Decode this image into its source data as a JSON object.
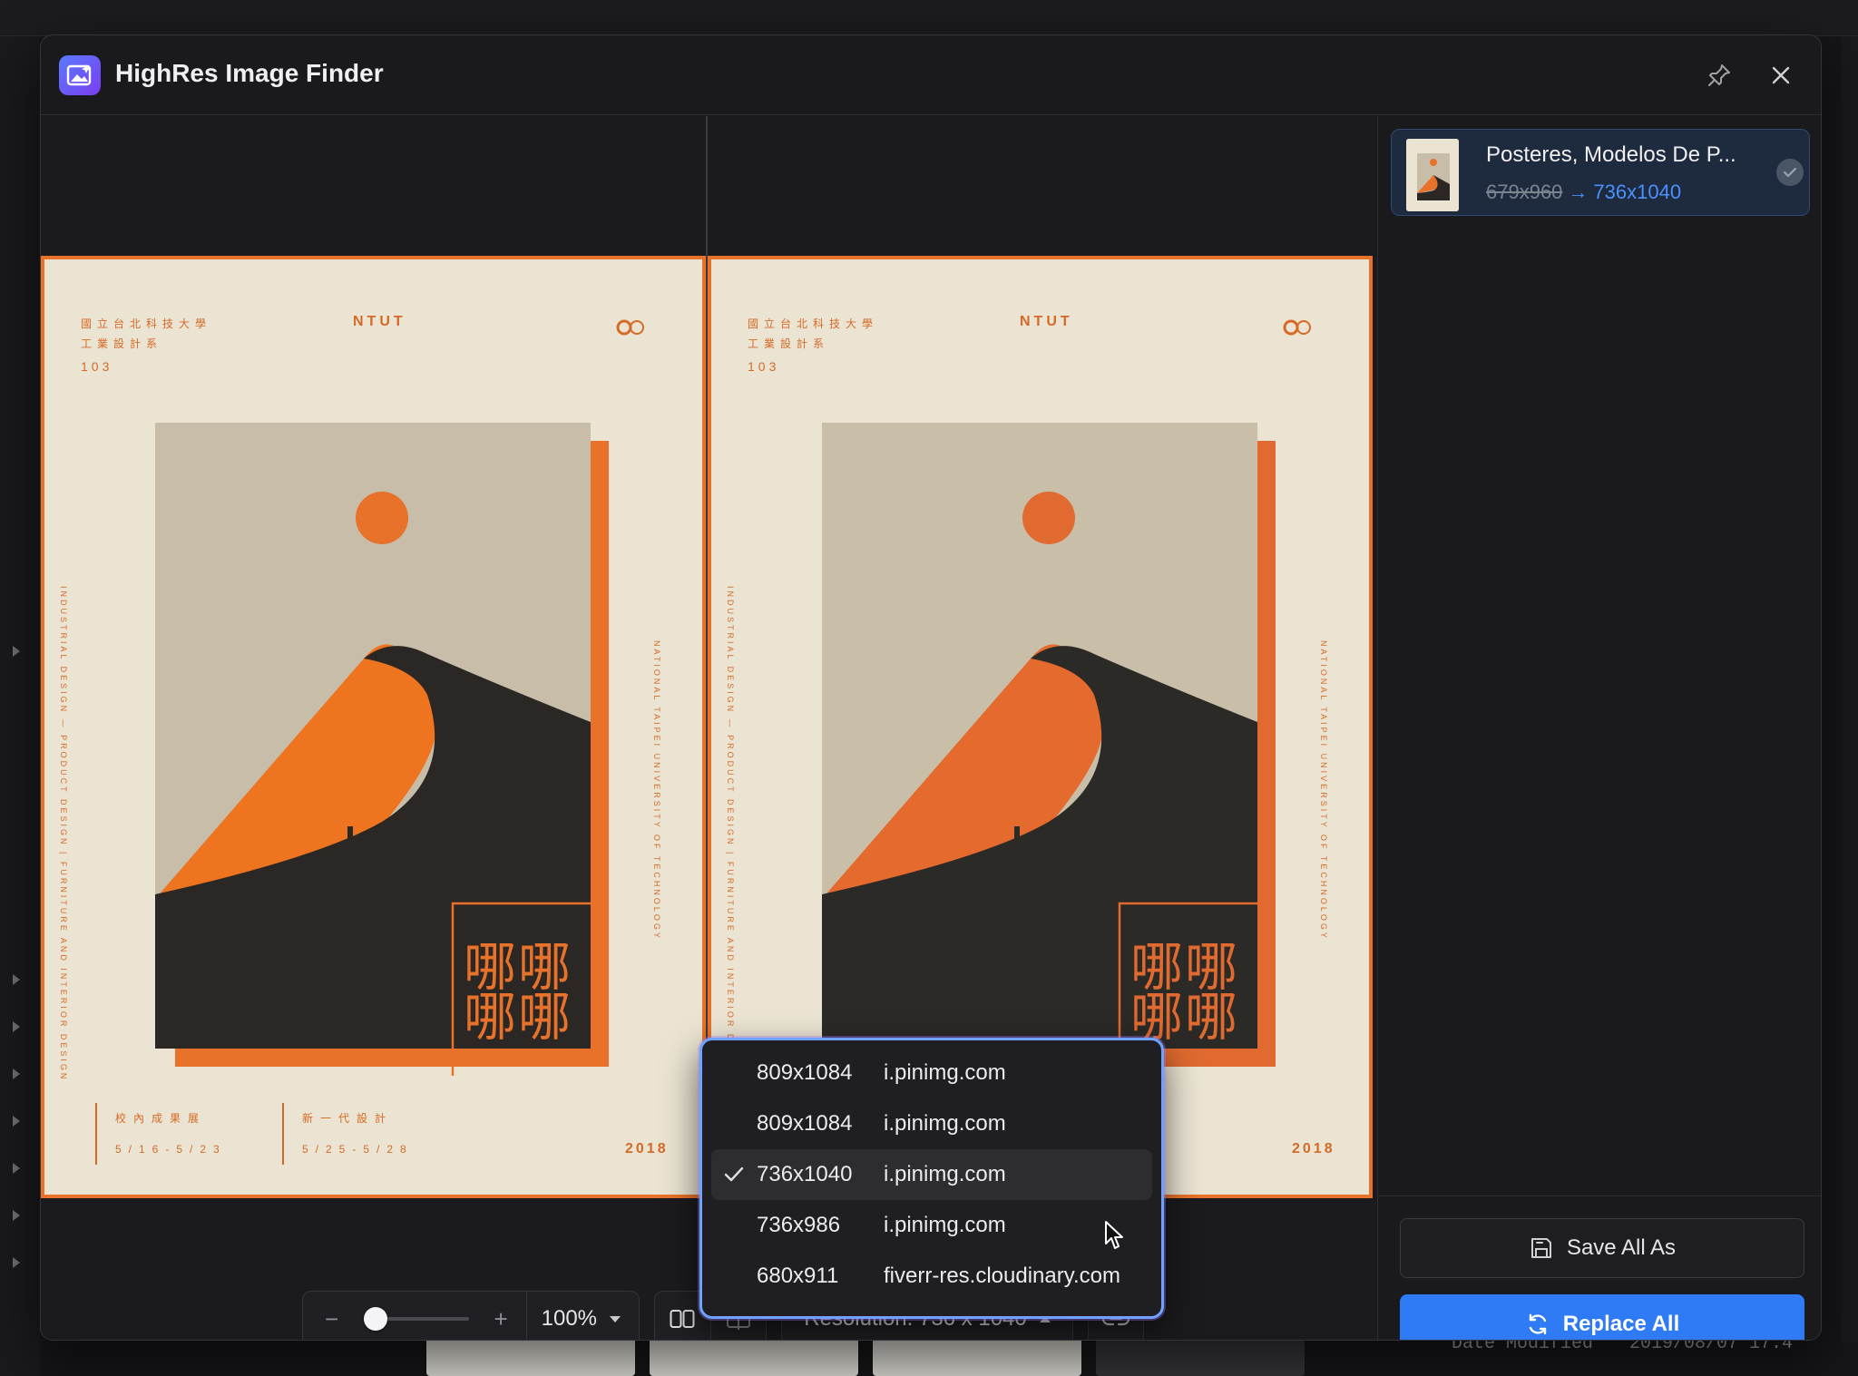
{
  "window": {
    "title": "HighRes Image Finder"
  },
  "poster": {
    "cjk_line1": "國立台北科技大學",
    "cjk_line2": "工業設計系",
    "number": "103",
    "school": "NTUT",
    "vertical_left": "INDUSTRIAL DESIGN — PRODUCT DESIGN | FURNITURE AND INTERIOR DESIGN",
    "vertical_right": "NATIONAL TAIPEI UNIVERSITY OF TECHNOLOGY",
    "footer1_title": "校內成果展",
    "footer1_date": "5/16-5/23",
    "footer2_title": "新一代設計",
    "footer2_date": "5/25-5/28",
    "year": "2018"
  },
  "toolbar": {
    "zoom_minus": "−",
    "zoom_plus": "+",
    "zoom_value": "100%",
    "zoom_level": 0.0,
    "resolution_label": "Resolution: 736 x 1040"
  },
  "resolution_menu": {
    "items": [
      {
        "resolution": "809x1084",
        "host": "i.pinimg.com",
        "selected": false
      },
      {
        "resolution": "809x1084",
        "host": "i.pinimg.com",
        "selected": false
      },
      {
        "resolution": "736x1040",
        "host": "i.pinimg.com",
        "selected": true
      },
      {
        "resolution": "736x986",
        "host": "i.pinimg.com",
        "selected": false
      },
      {
        "resolution": "680x911",
        "host": "fiverr-res.cloudinary.com",
        "selected": false
      }
    ]
  },
  "sidebar": {
    "result": {
      "title": "Posteres, Modelos De P...",
      "old_size": "679x960",
      "arrow": "→",
      "new_size": "736x1040"
    },
    "save_all_label": "Save All As",
    "replace_all_label": "Replace All"
  },
  "background": {
    "meta_label": "Date Modified",
    "meta_value": "2019/08/07 17:4"
  },
  "colors": {
    "accent_blue": "#2f7bf5",
    "poster_orange": "#e8722a",
    "poster_bg": "#ebe4d3",
    "dune_dark": "#2a2724",
    "menu_border": "#6fa2ff"
  }
}
